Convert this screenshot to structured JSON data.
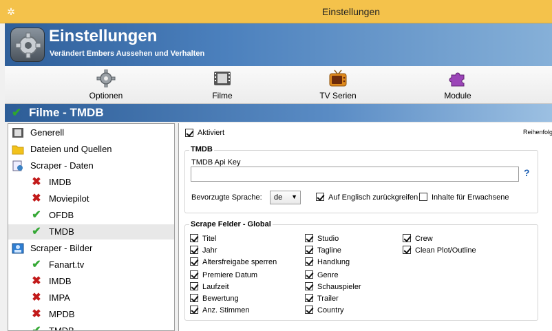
{
  "window": {
    "title": "Einstellungen",
    "icon": "gear-icon"
  },
  "banner": {
    "title": "Einstellungen",
    "subtitle": "Verändert Embers Aussehen und Verhalten"
  },
  "toolbar": {
    "items": [
      {
        "label": "Optionen",
        "icon": "gear-icon"
      },
      {
        "label": "Filme",
        "icon": "film-icon"
      },
      {
        "label": "TV Serien",
        "icon": "tv-icon"
      },
      {
        "label": "Module",
        "icon": "puzzle-icon"
      }
    ]
  },
  "section": {
    "title": "Filme - TMDB"
  },
  "tree": {
    "items": [
      {
        "label": "Generell",
        "icon": "film-icon"
      },
      {
        "label": "Dateien und Quellen",
        "icon": "folder-icon"
      },
      {
        "label": "Scraper - Daten",
        "icon": "data-scraper-icon"
      },
      {
        "label": "IMDB",
        "icon": "red-x-icon"
      },
      {
        "label": "Moviepilot",
        "icon": "red-x-icon"
      },
      {
        "label": "OFDB",
        "icon": "green-check-icon"
      },
      {
        "label": "TMDB",
        "icon": "green-check-icon",
        "selected": true
      },
      {
        "label": "Scraper - Bilder",
        "icon": "image-scraper-icon"
      },
      {
        "label": "Fanart.tv",
        "icon": "green-check-icon"
      },
      {
        "label": "IMDB",
        "icon": "red-x-icon"
      },
      {
        "label": "IMPA",
        "icon": "red-x-icon"
      },
      {
        "label": "MPDB",
        "icon": "red-x-icon"
      },
      {
        "label": "TMDB",
        "icon": "green-check-icon"
      }
    ]
  },
  "settings": {
    "activated_label": "Aktiviert",
    "order_label": "Reihenfolg",
    "tmdb_group": "TMDB",
    "api_key_label": "TMDB Api Key",
    "api_key_value": "",
    "help_label": "?",
    "language_label": "Bevorzugte Sprache:",
    "language_value": "de",
    "fallback_english_label": "Auf Englisch zurückgreifen",
    "adult_label": "Inhalte für Erwachsene",
    "scrape_group": "Scrape Felder - Global",
    "fields_col1": [
      "Titel",
      "Jahr",
      "Altersfreigabe sperren",
      "Premiere Datum",
      "Laufzeit",
      "Bewertung",
      "Anz. Stimmen"
    ],
    "fields_col2": [
      "Studio",
      "Tagline",
      "Handlung",
      "Genre",
      "Schauspieler",
      "Trailer",
      "Country"
    ],
    "fields_col3": [
      "Crew",
      "Clean Plot/Outline"
    ]
  }
}
